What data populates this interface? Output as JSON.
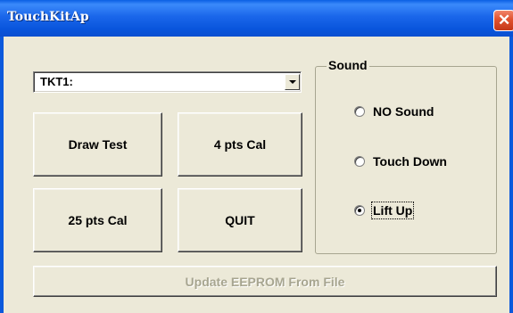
{
  "window": {
    "title": "TouchKitAp"
  },
  "combo": {
    "value": "TKT1:"
  },
  "buttons": {
    "draw_test": "Draw Test",
    "cal_4": "4 pts Cal",
    "cal_25": "25 pts Cal",
    "quit": "QUIT",
    "update_eeprom": "Update EEPROM From File"
  },
  "sound": {
    "label": "Sound",
    "options": [
      {
        "label": "NO Sound",
        "checked": false
      },
      {
        "label": "Touch Down",
        "checked": false
      },
      {
        "label": "Lift Up",
        "checked": true
      }
    ]
  },
  "colors": {
    "titlebar": "#0a55dc",
    "face": "#ece9d8",
    "close": "#e0512e"
  }
}
